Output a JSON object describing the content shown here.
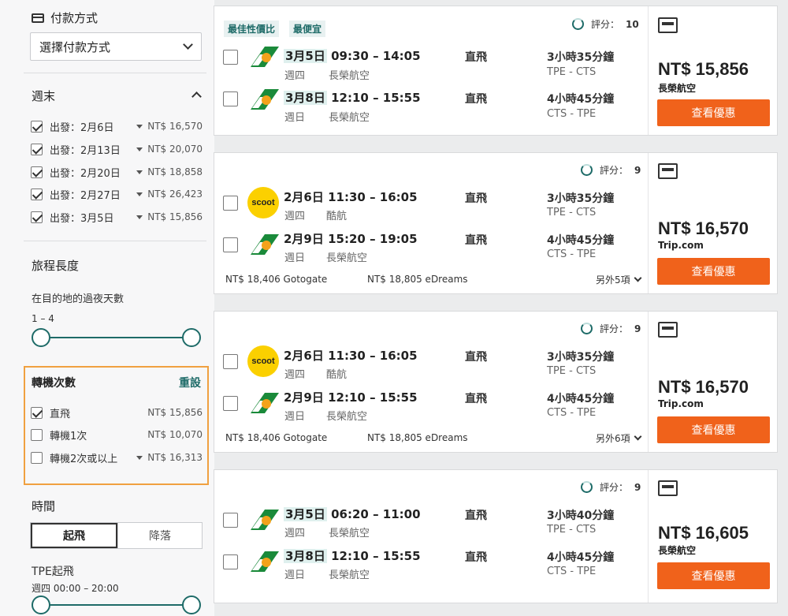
{
  "sidebar": {
    "payment": {
      "title": "付款方式",
      "select_value": "選擇付款方式"
    },
    "weekend": {
      "title": "週末",
      "options": [
        {
          "label": "出發：2月6日",
          "price": "NT$ 16,570",
          "checked": true
        },
        {
          "label": "出發：2月13日",
          "price": "NT$ 20,070",
          "checked": true
        },
        {
          "label": "出發：2月20日",
          "price": "NT$ 18,858",
          "checked": true
        },
        {
          "label": "出發：2月27日",
          "price": "NT$ 26,423",
          "checked": true
        },
        {
          "label": "出發：3月5日",
          "price": "NT$ 15,856",
          "checked": true
        }
      ]
    },
    "trip_length": {
      "title": "旅程長度",
      "desc": "在目的地的過夜天數",
      "range": "1 – 4"
    },
    "stops": {
      "title": "轉機次數",
      "reset": "重設",
      "options": [
        {
          "label": "直飛",
          "price": "NT$ 15,856",
          "checked": true,
          "funnel": false
        },
        {
          "label": "轉機1次",
          "price": "NT$ 10,070",
          "checked": false,
          "funnel": false
        },
        {
          "label": "轉機2次或以上",
          "price": "NT$ 16,313",
          "checked": false,
          "funnel": true
        }
      ]
    },
    "time": {
      "title": "時間",
      "tabs": [
        "起飛",
        "降落"
      ],
      "sub_title": "TPE起飛",
      "range": "週四 00:00 – 20:00"
    }
  },
  "results": [
    {
      "tags": [
        "最佳性價比",
        "最便宜"
      ],
      "score_label": "評分：",
      "score": "10",
      "price": "NT$ 15,856",
      "provider": "長榮航空",
      "button": "查看優惠",
      "legs": [
        {
          "date": "3月5日",
          "time": "09:30 – 14:05",
          "weekday": "週四",
          "airline": "長榮航空",
          "stops": "直飛",
          "duration": "3小時35分鐘",
          "route": "TPE - CTS"
        },
        {
          "date": "3月8日",
          "time": "12:10 – 15:55",
          "weekday": "週日",
          "airline": "長榮航空",
          "stops": "直飛",
          "duration": "4小時45分鐘",
          "route": "CTS - TPE"
        }
      ]
    },
    {
      "score_label": "評分：",
      "score": "9",
      "price": "NT$ 16,570",
      "provider": "Trip.com",
      "button": "查看優惠",
      "alt1": "NT$ 18,406 Gotogate",
      "alt2": "NT$ 18,805 eDreams",
      "more": "另外5項",
      "legs": [
        {
          "date": "2月6日",
          "time": "11:30 – 16:05",
          "weekday": "週四",
          "airline": "酷航",
          "stops": "直飛",
          "duration": "3小時35分鐘",
          "route": "TPE - CTS"
        },
        {
          "date": "2月9日",
          "time": "15:20 – 19:05",
          "weekday": "週日",
          "airline": "長榮航空",
          "stops": "直飛",
          "duration": "4小時45分鐘",
          "route": "CTS - TPE"
        }
      ]
    },
    {
      "score_label": "評分：",
      "score": "9",
      "price": "NT$ 16,570",
      "provider": "Trip.com",
      "button": "查看優惠",
      "alt1": "NT$ 18,406 Gotogate",
      "alt2": "NT$ 18,805 eDreams",
      "more": "另外6項",
      "legs": [
        {
          "date": "2月6日",
          "time": "11:30 – 16:05",
          "weekday": "週四",
          "airline": "酷航",
          "stops": "直飛",
          "duration": "3小時35分鐘",
          "route": "TPE - CTS"
        },
        {
          "date": "2月9日",
          "time": "12:10 – 15:55",
          "weekday": "週日",
          "airline": "長榮航空",
          "stops": "直飛",
          "duration": "4小時45分鐘",
          "route": "CTS - TPE"
        }
      ]
    },
    {
      "score_label": "評分：",
      "score": "9",
      "price": "NT$ 16,605",
      "provider": "長榮航空",
      "button": "查看優惠",
      "legs": [
        {
          "date": "3月5日",
          "time": "06:20 – 11:00",
          "weekday": "週四",
          "airline": "長榮航空",
          "stops": "直飛",
          "duration": "3小時40分鐘",
          "route": "TPE - CTS"
        },
        {
          "date": "3月8日",
          "time": "12:10 – 15:55",
          "weekday": "週日",
          "airline": "長榮航空",
          "stops": "直飛",
          "duration": "4小時45分鐘",
          "route": "CTS - TPE"
        }
      ]
    }
  ],
  "logos": {
    "scoot_text": "scoot"
  },
  "colors": {
    "accent": "#1e6b68",
    "cta": "#f0621b",
    "highlight_box": "#f0a040"
  }
}
